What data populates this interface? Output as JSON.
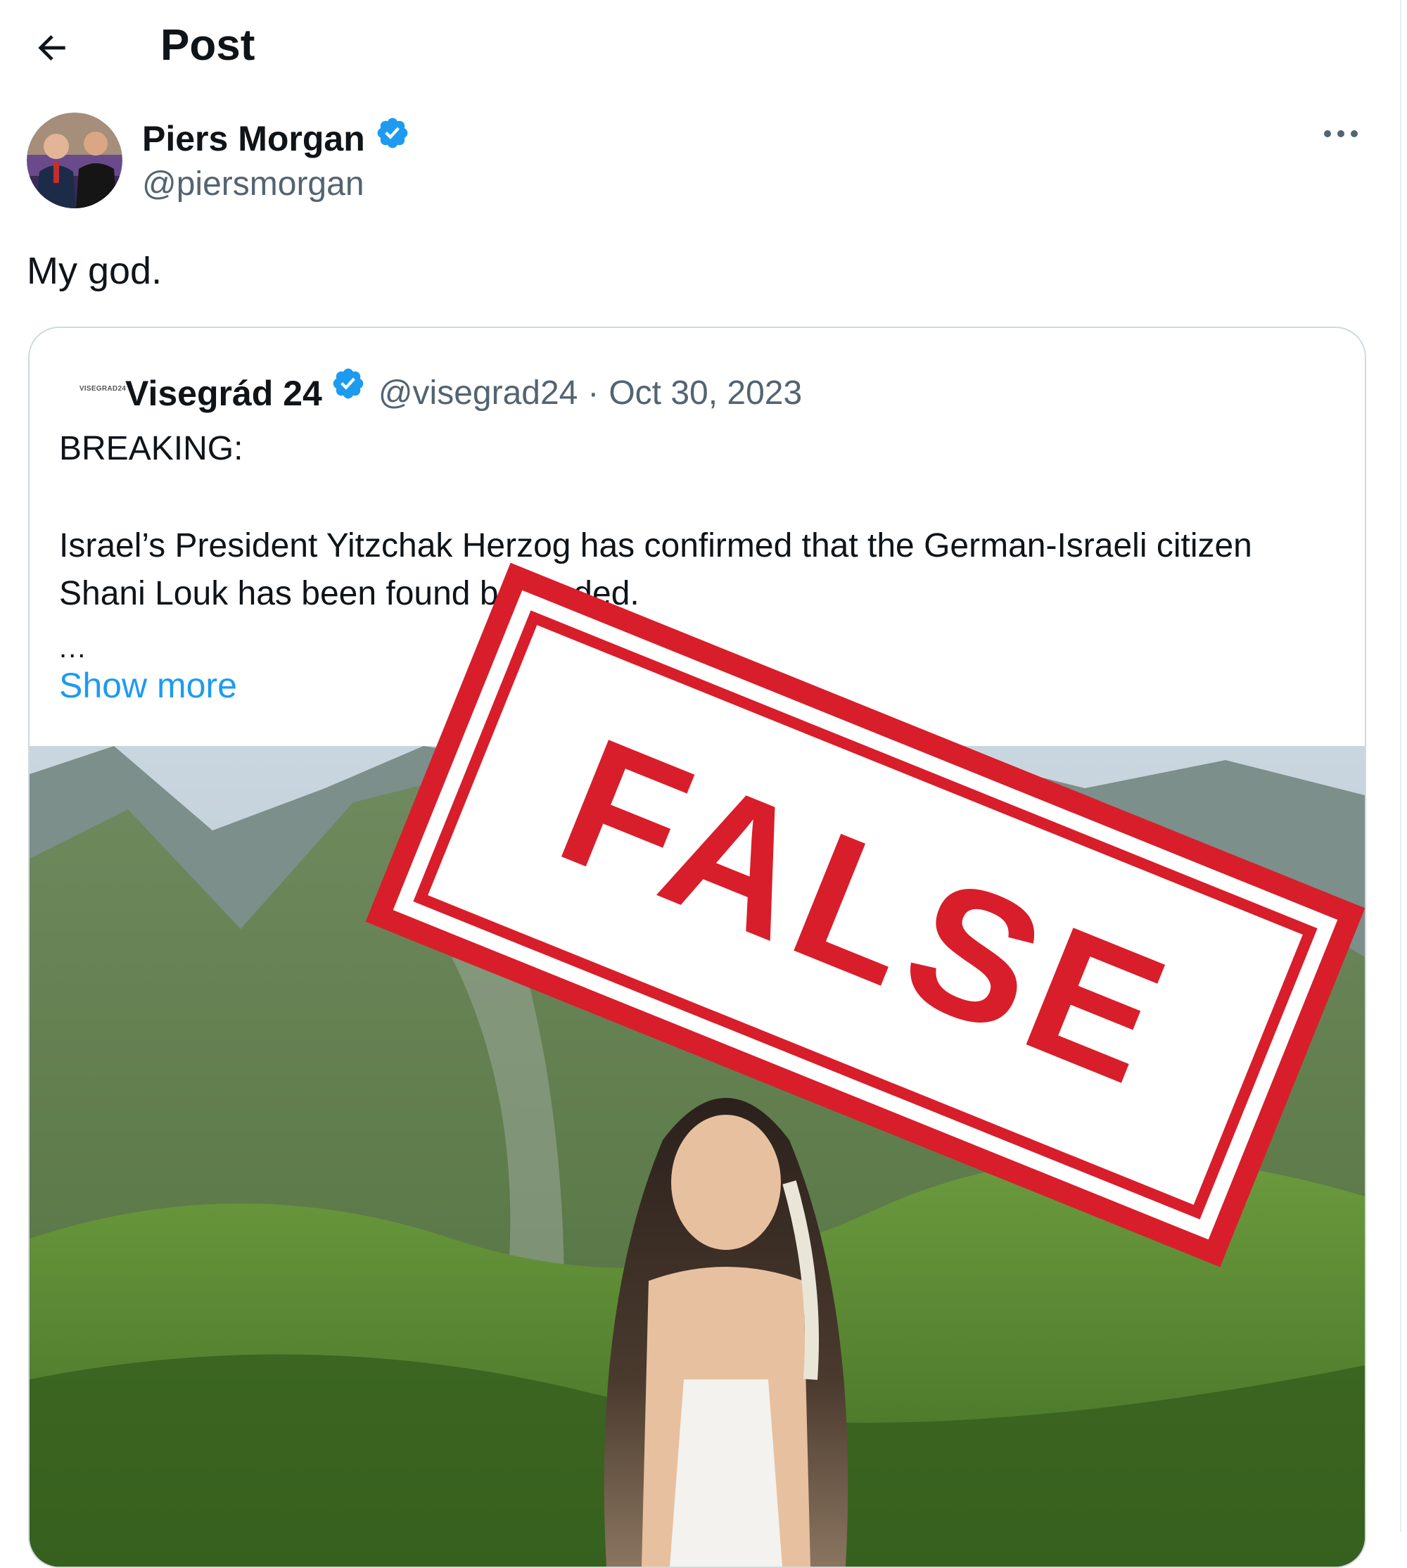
{
  "header": {
    "title": "Post",
    "back_icon": "arrow-left-icon"
  },
  "author": {
    "name": "Piers Morgan",
    "handle": "@piersmorgan",
    "verified_icon": "verified-badge-icon",
    "more_icon": "more-horizontal-icon"
  },
  "post": {
    "text": "My god."
  },
  "quote": {
    "logo_text": "VISEGRAD24",
    "name": "Visegrád 24",
    "handle": "@visegrad24",
    "separator": "·",
    "date": "Oct 30, 2023",
    "breaking": "BREAKING:",
    "body": "Israel’s President Yitzchak Herzog has confirmed that the German-Israeli citizen Shani Louk has been found beheaded.",
    "ellipsis": "...",
    "show_more": "Show more"
  },
  "stamp": {
    "text": "FALSE"
  },
  "colors": {
    "accent": "#1d9bf0",
    "stamp_red": "#d81e2a",
    "secondary_text": "#536471",
    "border": "#cfd9de"
  }
}
